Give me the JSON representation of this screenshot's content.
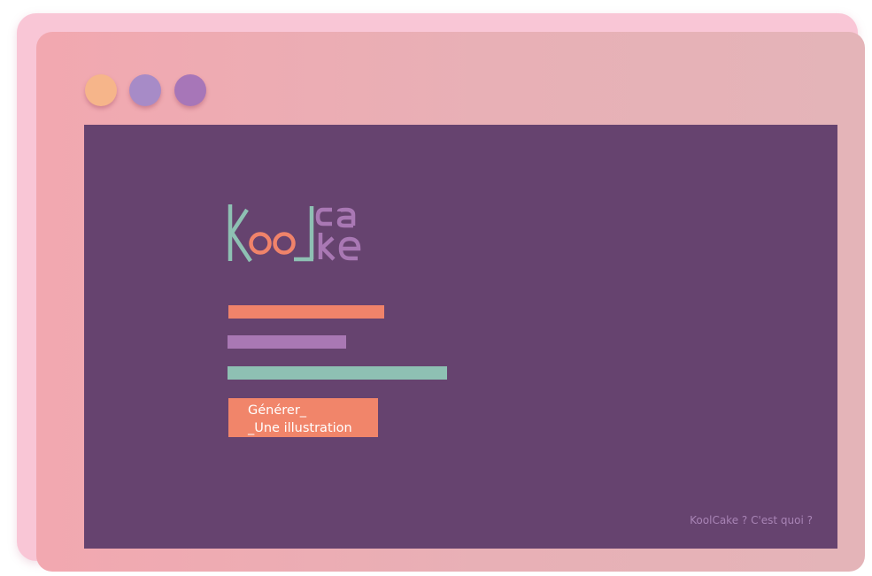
{
  "window": {
    "controls": [
      {
        "name": "window-dot-orange",
        "color": "#f6b58a"
      },
      {
        "name": "window-dot-lavender",
        "color": "#a78bc7"
      },
      {
        "name": "window-dot-purple",
        "color": "#a776b8"
      }
    ]
  },
  "logo": {
    "text": "KoolCake",
    "colors": {
      "k": "#8ec0b3",
      "oo": "#f0836a",
      "l": "#8ec0b3",
      "cake": "#a978b4"
    }
  },
  "theme": {
    "background": "#66436f",
    "accent_orange": "#f0836a",
    "accent_purple": "#a978b4",
    "accent_teal": "#8ec0b3"
  },
  "generate_button": {
    "line1": "Générer_",
    "line2": "_Une illustration"
  },
  "footer": {
    "about_link": "KoolCake ? C'est quoi ?"
  }
}
